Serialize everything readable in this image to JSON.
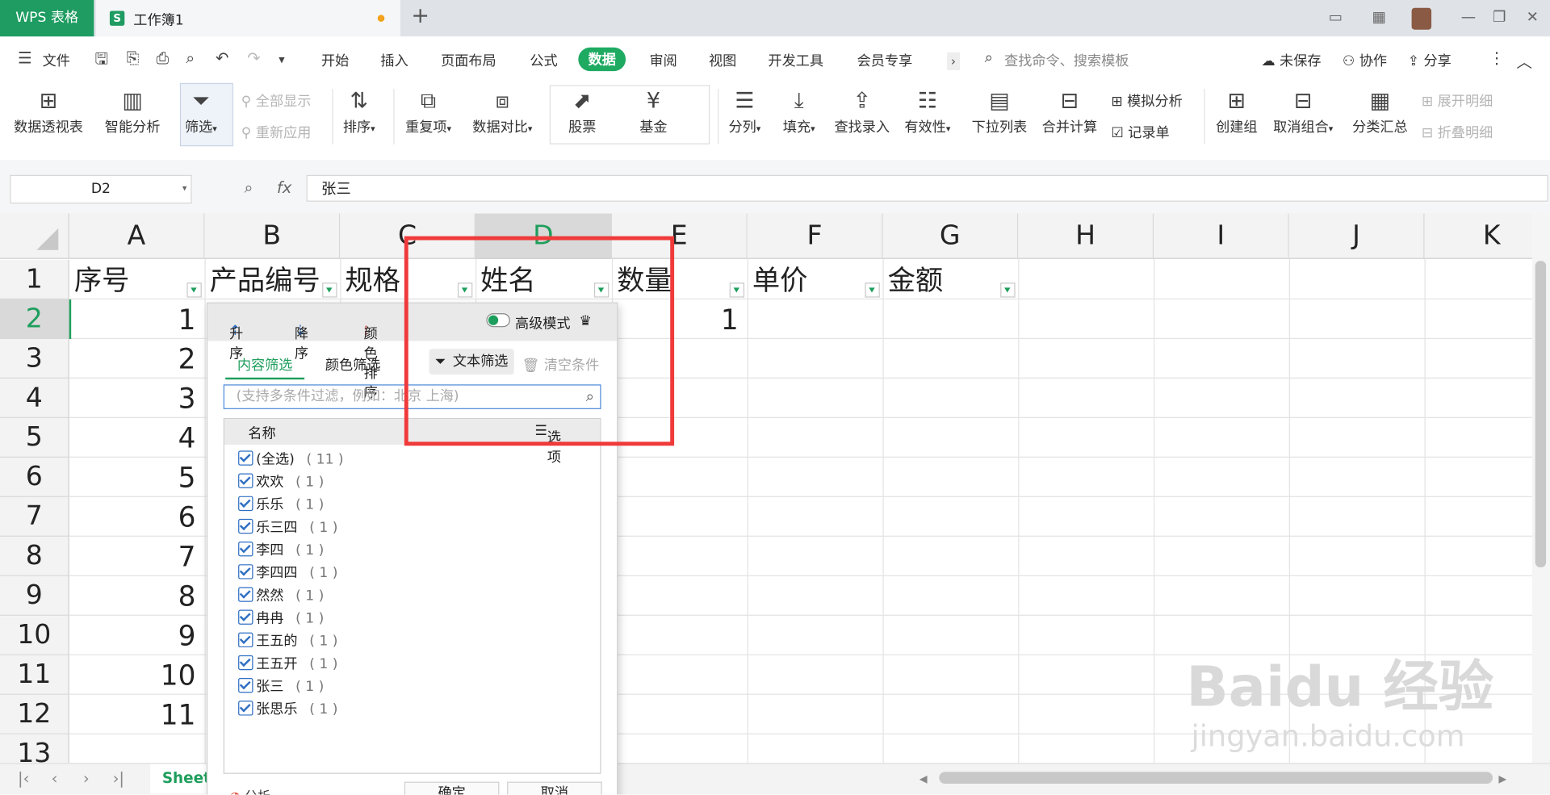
{
  "titlebar": {
    "app_tab": "WPS 表格",
    "doc_icon": "S",
    "doc_name": "工作簿1",
    "new_tab": "+"
  },
  "menu": {
    "file": "文件",
    "items": [
      "开始",
      "插入",
      "页面布局",
      "公式",
      "数据",
      "审阅",
      "视图",
      "开发工具",
      "会员专享"
    ],
    "active": "数据",
    "search_placeholder": "查找命令、搜索模板",
    "right": [
      "未保存",
      "协作",
      "分享"
    ]
  },
  "ribbon": {
    "pivot": "数据透视表",
    "smart": "智能分析",
    "filter": "筛选",
    "show_all": "全部显示",
    "reapply": "重新应用",
    "sort": "排序",
    "dup": "重复项",
    "compare": "数据对比",
    "stock": "股票",
    "fund": "基金",
    "split": "分列",
    "fill": "填充",
    "lookup": "查找录入",
    "valid": "有效性",
    "dropdown": "下拉列表",
    "merge": "合并计算",
    "simulate": "模拟分析",
    "record": "记录单",
    "group": "创建组",
    "ungroup": "取消组合",
    "subtotal": "分类汇总",
    "expand": "展开明细",
    "collapse": "折叠明细"
  },
  "formula_bar": {
    "cell_ref": "D2",
    "fx": "fx",
    "value": "张三"
  },
  "sheet": {
    "columns": [
      "A",
      "B",
      "C",
      "D",
      "E",
      "F",
      "G",
      "H",
      "I",
      "J",
      "K"
    ],
    "selected_column": "D",
    "rows": [
      "1",
      "2",
      "3",
      "4",
      "5",
      "6",
      "7",
      "8",
      "9",
      "10",
      "11",
      "12",
      "13"
    ],
    "selected_row": "2",
    "headers": [
      "序号",
      "产品编号",
      "规格",
      "姓名",
      "数量",
      "单价",
      "金额"
    ],
    "col_a_values": [
      "1",
      "2",
      "3",
      "4",
      "5",
      "6",
      "7",
      "8",
      "9",
      "10",
      "11"
    ],
    "e2_value": "1",
    "tab_name": "Sheet"
  },
  "filter_popup": {
    "asc": "升序",
    "desc": "降序",
    "color_sort": "颜色排序",
    "advanced": "高级模式",
    "tab_content": "内容筛选",
    "tab_color": "颜色筛选",
    "text_filter": "文本筛选",
    "clear": "清空条件",
    "search_placeholder": "(支持多条件过滤，例如：北京 上海)",
    "list_header": "名称",
    "options": "选项",
    "items": [
      {
        "label": "(全选)",
        "count": "( 11 )"
      },
      {
        "label": "欢欢",
        "count": "( 1 )"
      },
      {
        "label": "乐乐",
        "count": "( 1 )"
      },
      {
        "label": "乐三四",
        "count": "( 1 )"
      },
      {
        "label": "李四",
        "count": "( 1 )"
      },
      {
        "label": "李四四",
        "count": "( 1 )"
      },
      {
        "label": "然然",
        "count": "( 1 )"
      },
      {
        "label": "冉冉",
        "count": "( 1 )"
      },
      {
        "label": "王五的",
        "count": "( 1 )"
      },
      {
        "label": "王五开",
        "count": "( 1 )"
      },
      {
        "label": "张三",
        "count": "( 1 )"
      },
      {
        "label": "张思乐",
        "count": "( 1 )"
      }
    ],
    "analysis": "分析",
    "ok": "确定",
    "cancel": "取消"
  },
  "watermark": {
    "line1": "Baidu 经验",
    "line2": "jingyan.baidu.com"
  },
  "colors": {
    "accent": "#1e9e5c",
    "annotation": "#f03a3a"
  }
}
